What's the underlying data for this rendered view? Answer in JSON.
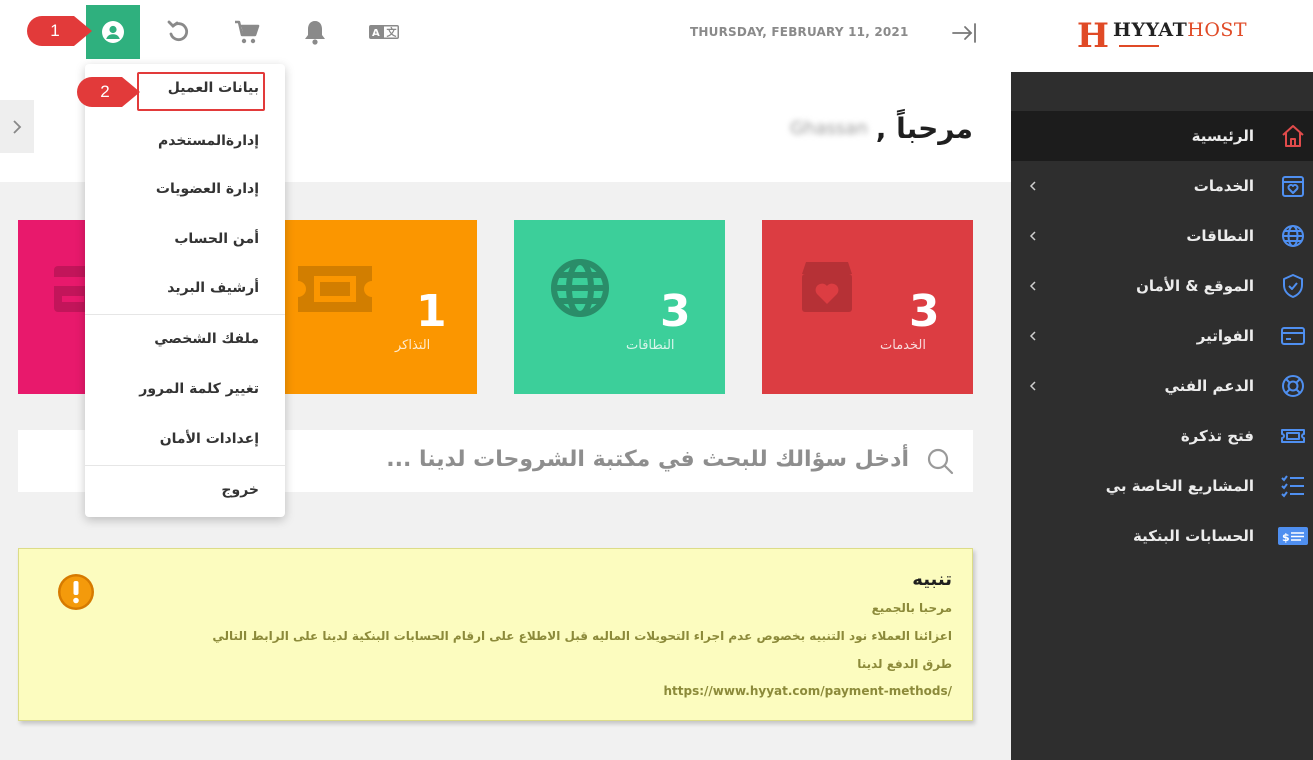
{
  "brand": {
    "logo_letter": "H",
    "logo_word_1": "HYYAT",
    "logo_word_2": "HOST"
  },
  "sidebar": {
    "items": [
      {
        "label": "الرئيسية",
        "icon": "home-icon",
        "active": true,
        "has_submenu": false
      },
      {
        "label": "الخدمات",
        "icon": "box-heart-icon",
        "active": false,
        "has_submenu": true
      },
      {
        "label": "النطاقات",
        "icon": "globe-icon",
        "active": false,
        "has_submenu": true
      },
      {
        "label": "الموقع & الأمان",
        "icon": "shield-check-icon",
        "active": false,
        "has_submenu": true
      },
      {
        "label": "الفواتير",
        "icon": "credit-card-icon",
        "active": false,
        "has_submenu": true
      },
      {
        "label": "الدعم الفني",
        "icon": "lifebuoy-icon",
        "active": false,
        "has_submenu": true
      },
      {
        "label": "فتح تذكرة",
        "icon": "ticket-icon",
        "active": false,
        "has_submenu": false
      },
      {
        "label": "المشاريع الخاصة بي",
        "icon": "checklist-icon",
        "active": false,
        "has_submenu": false
      },
      {
        "label": "الحسابات البنكية",
        "icon": "bank-card-icon",
        "active": false,
        "has_submenu": false
      }
    ]
  },
  "topbar": {
    "date": "THURSDAY, FEBRUARY 11, 2021",
    "icons": [
      "user-icon",
      "refresh-icon",
      "cart-icon",
      "bell-icon",
      "translate-icon",
      "collapse-sidebar-icon"
    ]
  },
  "welcome": {
    "greeting": "مرحباً ,",
    "user_name": "Ghassan"
  },
  "cards": [
    {
      "number": "3",
      "label": "الخدمات",
      "color": "#dc3d42",
      "icon": "box-heart-icon"
    },
    {
      "number": "3",
      "label": "النطاقات",
      "color": "#3ccf9a",
      "icon": "globe-icon"
    },
    {
      "number": "1",
      "label": "التذاكر",
      "color": "#fb9600",
      "icon": "ticket-icon"
    },
    {
      "number": "",
      "label": "",
      "color": "#e8196c",
      "icon": "credit-card-icon"
    }
  ],
  "search": {
    "placeholder": "أدخل سؤالك للبحث في مكتبة الشروحات لدينا ..."
  },
  "alert": {
    "title": "تنبيه",
    "lines": [
      "مرحبا بالجميع",
      "اعزائنا العملاء نود التنبيه بخصوص عدم اجراء التحويلات الماليه قبل الاطلاع على ارقام الحسابات البنكية لدينا على الرابط التالي",
      "طرق الدفع لدينا",
      "https://www.hyyat.com/payment-methods/"
    ]
  },
  "dropdown": {
    "items": [
      "بيانات العميل",
      "إدارةالمستخدم",
      "إدارة العضويات",
      "أمن الحساب",
      "أرشيف البريد",
      "ملفك الشخصي",
      "تغيير كلمة المرور",
      "إعدادات الأمان",
      "خروج"
    ]
  },
  "annotations": [
    {
      "number": "1"
    },
    {
      "number": "2"
    }
  ],
  "colors": {
    "brand_orange": "#e04a26",
    "sidebar_bg": "#2e2e2e",
    "sidebar_active": "#1c1c1c",
    "sidebar_icon": "#4f8ff0",
    "user_button": "#2fb07e",
    "annotation_red": "#e23a3a",
    "alert_bg": "#fcfcbf",
    "alert_text": "#8c8a3a"
  }
}
